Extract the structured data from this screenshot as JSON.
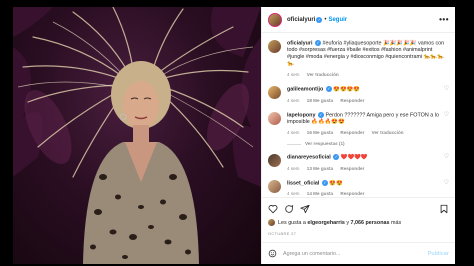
{
  "post": {
    "username": "oficialyuri",
    "follow_label": "Seguir",
    "more_label": "•••",
    "caption": {
      "username": "oficialyuri",
      "text": "#euforia #yliaquesoporte 🎉🎉🎉🎉🎉 vamos con todo #sorpresas #fuerza #baile #exitos #fashion #animalprint #jungle #moda #energia y #diosconmigo #quiencontrami 🐆🐆🐆🐆",
      "time": "4 sem",
      "translation": "Ver traducción"
    },
    "comments": [
      {
        "username": "galileamontijo",
        "text": "😍😍😍😍",
        "time": "4 sem",
        "likes": "18 Me gusta",
        "reply": "Responder"
      },
      {
        "username": "lapelopony",
        "text": "Perdon ??????? Amiga pero y ese FOTON a lo imposible 🔥🔥🔥😍😍",
        "time": "4 sem",
        "likes": "16 Me gusta",
        "reply": "Responder",
        "translation": "Ver traducción",
        "view_replies": "Ver respuestas (1)"
      },
      {
        "username": "dianareyesoficial",
        "text": "❤️❤️❤️❤️",
        "time": "4 sem",
        "likes": "13 Me gusta",
        "reply": "Responder"
      },
      {
        "username": "lisset_oficial",
        "text": "😍😍",
        "time": "4 sem",
        "likes": "14 Me gusta",
        "reply": "Responder"
      }
    ],
    "likes_summary": {
      "prefix": "Les gusta a",
      "user": "elgeorgeharris",
      "middle": "y",
      "count": "7,066 personas",
      "suffix": "más"
    },
    "date": "OCTUBRE 27",
    "add_comment_placeholder": "Agrega un comentario...",
    "publish_label": "Publicar"
  }
}
